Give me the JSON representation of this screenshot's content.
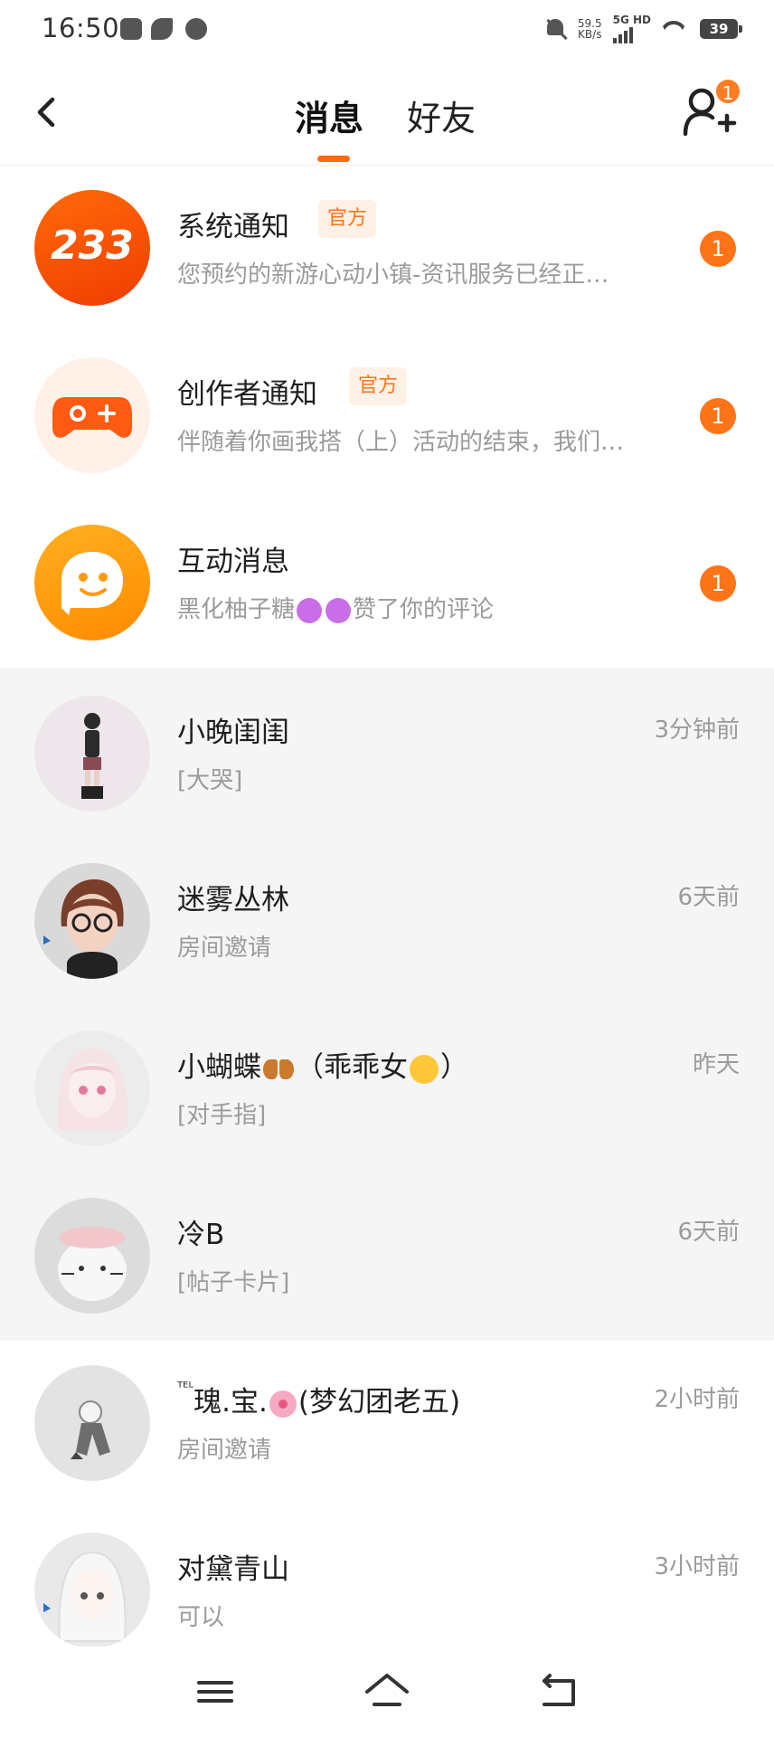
{
  "status_bar": {
    "time": "16:50",
    "net_speed_value": "59.5",
    "net_speed_unit": "KB/s",
    "network": "5G HD",
    "battery": "39"
  },
  "header": {
    "tabs": [
      {
        "label": "消息",
        "active": true
      },
      {
        "label": "好友",
        "active": false
      }
    ],
    "add_friend_badge": "1",
    "accent_color": "#ff6a13"
  },
  "system_rows": [
    {
      "title": "系统通知",
      "tag": "官方",
      "preview": "您预约的新游心动小镇-资讯服务已经正…",
      "unread": "1",
      "avatar_text": "233",
      "icon": "233-logo-icon"
    },
    {
      "title": "创作者通知",
      "tag": "官方",
      "preview": "伴随着你画我搭（上）活动的结束，我们…",
      "unread": "1",
      "icon": "gamepad-icon"
    },
    {
      "title": "互动消息",
      "preview_name": "黑化柚子糖",
      "preview_action": "赞了你的评论",
      "unread": "1",
      "icon": "chat-bubble-icon"
    }
  ],
  "chats": [
    {
      "name": "小晚闺闺",
      "time": "3分钟前",
      "preview": "[大哭]",
      "pinned": true
    },
    {
      "name": "迷雾丛林",
      "time": "6天前",
      "preview": "房间邀请",
      "pinned": true
    },
    {
      "name_a": "小蝴蝶",
      "name_b": "（乖乖女",
      "name_c": "）",
      "time": "昨天",
      "preview": "[对手指]",
      "pinned": true
    },
    {
      "name": "冷B",
      "time": "6天前",
      "preview": "[帖子卡片]",
      "pinned": true
    },
    {
      "name_prefix": "ᵀᴱᴸ",
      "name_a": "瑰.宝.",
      "name_b": "(梦幻团老五)",
      "time": "2小时前",
      "preview": "房间邀请",
      "pinned": false
    },
    {
      "name": "对黛青山",
      "time": "3小时前",
      "preview": "可以",
      "pinned": false
    }
  ]
}
